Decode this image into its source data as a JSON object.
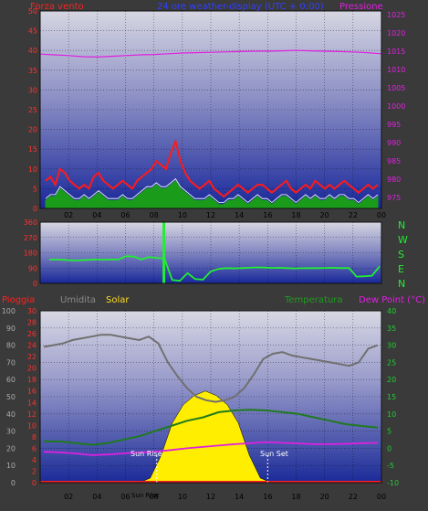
{
  "header": {
    "wind_label": "Forza vento",
    "subtitle": "24 ore weather-display (UTC + 0:00)",
    "pressure_label": "Pressione"
  },
  "direction_labels": [
    "N",
    "W",
    "S",
    "E",
    "N"
  ],
  "middle_header": {
    "rain_label": "Pioggia",
    "humidity_label": "Umidita",
    "solar_label": "Solar",
    "temperature_label": "Temperatura",
    "dewpoint_label": "Dew Point (°C)"
  },
  "annotations": {
    "sunrise": "Sun Rise",
    "sunset": "Sun Set",
    "x_extra": "Sun Rise"
  },
  "colors": {
    "wind": "#ff1a1a",
    "gust": "#1a9c1a",
    "pressure": "#e020e0",
    "direction": "#22ee33",
    "humidity": "#707070",
    "temperature": "#1f7a1f",
    "dewpoint": "#e020e0",
    "solar": "#ffee00",
    "rain": "#ff2020",
    "left_axis": "#ff3030",
    "right_axis_pressure": "#e020e0",
    "right_axis_temp": "#22cc33"
  },
  "chart_data": [
    {
      "type": "line",
      "name": "wind-pressure",
      "x_ticks": [
        "02",
        "04",
        "06",
        "08",
        "10",
        "12",
        "14",
        "16",
        "18",
        "20",
        "22",
        "00"
      ],
      "left_axis": {
        "label": "Forza vento",
        "ticks": [
          0,
          5,
          10,
          15,
          20,
          25,
          30,
          35,
          40,
          45,
          50
        ],
        "ylim": [
          0,
          50
        ]
      },
      "right_axis": {
        "label": "Pressione",
        "ticks": [
          975,
          980,
          985,
          990,
          995,
          1000,
          1005,
          1010,
          1015,
          1020,
          1025
        ],
        "ylim": [
          972,
          1026
        ]
      },
      "series": [
        {
          "axis": "left",
          "values": [
            7,
            8,
            6,
            10,
            9,
            7,
            6,
            5,
            6,
            5,
            8,
            9,
            7,
            6,
            5,
            6,
            7,
            6,
            5,
            7,
            8,
            9,
            10,
            12,
            11,
            10,
            14,
            17,
            12,
            9,
            7,
            6,
            5,
            6,
            7,
            5,
            4,
            3,
            4,
            5,
            6,
            5,
            4,
            5,
            6,
            6,
            5,
            4,
            5,
            6,
            7,
            5,
            4,
            5,
            6,
            5,
            7,
            6,
            5,
            6,
            5,
            6,
            7,
            6,
            5,
            4,
            5,
            6,
            5,
            6
          ]
        },
        {
          "axis": "left",
          "values": [
            2,
            3,
            3,
            5,
            4,
            3,
            2,
            2,
            3,
            2,
            3,
            4,
            3,
            2,
            2,
            2,
            3,
            2,
            2,
            3,
            4,
            5,
            5,
            6,
            5,
            5,
            6,
            7,
            5,
            4,
            3,
            2,
            2,
            2,
            3,
            2,
            1,
            1,
            2,
            2,
            3,
            2,
            1,
            2,
            3,
            2,
            2,
            1,
            2,
            3,
            3,
            2,
            1,
            2,
            3,
            2,
            3,
            2,
            2,
            3,
            2,
            3,
            3,
            2,
            2,
            1,
            2,
            3,
            2,
            3
          ]
        },
        {
          "axis": "right",
          "values": [
            1014.2,
            1014.0,
            1013.8,
            1013.5,
            1013.4,
            1013.6,
            1013.8,
            1014.0,
            1014.1,
            1014.3,
            1014.5,
            1014.6,
            1014.7,
            1014.8,
            1014.9,
            1015.0,
            1015.0,
            1015.1,
            1015.2,
            1015.1,
            1015.0,
            1014.9,
            1014.8,
            1014.6,
            1014.3
          ]
        }
      ]
    },
    {
      "type": "line",
      "name": "wind-direction",
      "y_ticks": [
        0,
        90,
        180,
        270,
        360
      ],
      "ylim": [
        0,
        360
      ],
      "series": [
        {
          "values": [
            140,
            140,
            138,
            135,
            136,
            138,
            140,
            139,
            141,
            140,
            160,
            158,
            140,
            155,
            150,
            145,
            20,
            15,
            60,
            25,
            22,
            70,
            85,
            90,
            88,
            90,
            92,
            94,
            93,
            91,
            92,
            90,
            88,
            89,
            90,
            90,
            91,
            92,
            90,
            91,
            40,
            42,
            45,
            100
          ]
        }
      ]
    },
    {
      "type": "line",
      "name": "humidity-temperature-solar",
      "left_axis": {
        "label": "Umidita",
        "ticks": [
          0,
          10,
          20,
          30,
          40,
          50,
          60,
          70,
          80,
          90,
          100
        ],
        "ylim": [
          0,
          100
        ]
      },
      "rain_axis": {
        "label": "Pioggia",
        "ticks": [
          0,
          2,
          4,
          6,
          8,
          10,
          12,
          14,
          16,
          18,
          20,
          22,
          24,
          26,
          28,
          30
        ],
        "ylim": [
          0,
          30
        ]
      },
      "right_axis": {
        "label": "Temperatura",
        "ticks": [
          -10,
          -5,
          0,
          5,
          10,
          15,
          20,
          25,
          30,
          35,
          40
        ],
        "ylim": [
          -10,
          40
        ]
      },
      "series": [
        {
          "name": "Umidita",
          "values": [
            79,
            80,
            81,
            83,
            84,
            85,
            86,
            86,
            85,
            84,
            83,
            85,
            81,
            70,
            62,
            55,
            50,
            48,
            47,
            48,
            50,
            55,
            63,
            72,
            75,
            76,
            74,
            73,
            72,
            71,
            70,
            69,
            68,
            70,
            78,
            80
          ]
        },
        {
          "name": "Temperatura",
          "values": [
            2,
            2,
            1.5,
            1,
            1.5,
            2.5,
            3.5,
            5,
            6.5,
            8,
            9,
            10.5,
            11,
            11.2,
            11,
            10.5,
            10,
            9,
            8,
            7,
            6.5,
            6
          ]
        },
        {
          "name": "Dew Point",
          "values": [
            -1,
            -1.2,
            -1.5,
            -2,
            -1.8,
            -1.5,
            -1.2,
            -1,
            -0.5,
            0,
            0.4,
            0.8,
            1.2,
            1.5,
            1.8,
            1.6,
            1.4,
            1.2,
            1.2,
            1.3,
            1.5,
            1.6
          ]
        },
        {
          "name": "Solar",
          "values": [
            0,
            0,
            0,
            0,
            0,
            0,
            0,
            0,
            0,
            0,
            1,
            6,
            13,
            17,
            19,
            20,
            19,
            17,
            13,
            6,
            1,
            0,
            0,
            0,
            0,
            0,
            0,
            0,
            0,
            0,
            0,
            0
          ]
        },
        {
          "name": "Pioggia",
          "values": [
            0,
            0,
            0,
            0,
            0,
            0,
            0,
            0,
            0,
            0,
            0,
            0,
            0,
            0,
            0,
            0,
            0,
            0,
            0,
            0,
            0,
            0,
            0,
            0,
            0,
            0,
            0,
            0,
            0,
            0,
            0,
            0
          ]
        }
      ]
    }
  ]
}
